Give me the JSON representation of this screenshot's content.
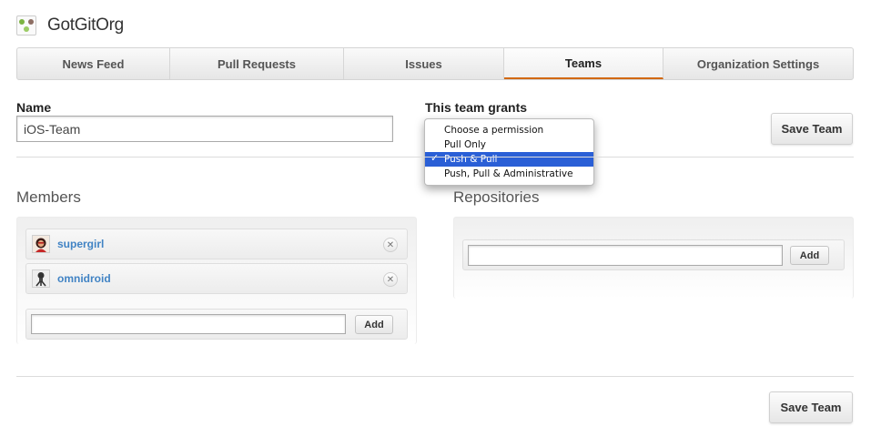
{
  "org": {
    "name": "GotGitOrg",
    "avatar_icon": "org-avatar-icon"
  },
  "tabs": [
    {
      "label": "News Feed",
      "selected": false
    },
    {
      "label": "Pull Requests",
      "selected": false
    },
    {
      "label": "Issues",
      "selected": false
    },
    {
      "label": "Teams",
      "selected": true
    },
    {
      "label": "Organization Settings",
      "selected": false
    }
  ],
  "form": {
    "name_label": "Name",
    "name_value": "iOS-Team",
    "grants_label": "This team grants",
    "save_label": "Save Team"
  },
  "permission_menu": {
    "options": [
      {
        "label": "Choose a permission",
        "selected": false
      },
      {
        "label": "Pull Only",
        "selected": false
      },
      {
        "label": "Push & Pull",
        "selected": true
      },
      {
        "label": "Push, Pull & Administrative",
        "selected": false
      }
    ],
    "check_glyph": "✓"
  },
  "members": {
    "title": "Members",
    "list": [
      {
        "name": "supergirl",
        "avatar_icon": "supergirl-avatar-icon"
      },
      {
        "name": "omnidroid",
        "avatar_icon": "omnidroid-avatar-icon"
      }
    ],
    "remove_glyph": "✕",
    "input_value": "",
    "add_label": "Add"
  },
  "repositories": {
    "title": "Repositories",
    "input_value": "",
    "add_label": "Add"
  },
  "colors": {
    "link": "#4183c4",
    "tab_underline": "#d26911",
    "menu_highlight": "#2a5fd6"
  }
}
